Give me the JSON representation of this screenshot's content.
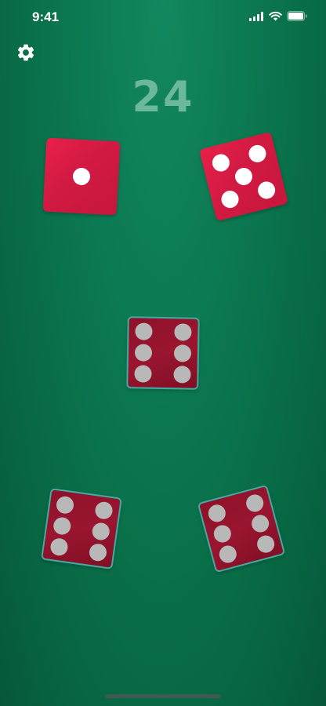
{
  "status_bar": {
    "time": "9:41"
  },
  "icons": {
    "settings": "gear-icon",
    "signal": "signal-icon",
    "wifi": "wifi-icon",
    "battery": "battery-icon"
  },
  "score": {
    "value": "24"
  },
  "dice": {
    "rolled": [
      {
        "face": 1
      },
      {
        "face": 5
      }
    ],
    "held": [
      {
        "face": 6
      },
      {
        "face": 6
      },
      {
        "face": 6
      }
    ]
  },
  "colors": {
    "table": "#0c7a52",
    "die_active": "#e0204a",
    "die_held": "#8e1229",
    "held_border": "#4aa6a0",
    "score": "#6bb89a"
  }
}
